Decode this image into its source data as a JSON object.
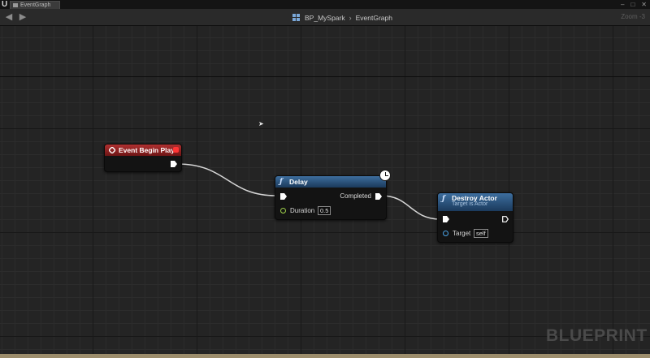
{
  "window": {
    "tab_label": "EventGraph"
  },
  "toolbar": {
    "breadcrumb": [
      "BP_MySpark",
      "EventGraph"
    ],
    "breadcrumb_separator": "›",
    "zoom": "Zoom -3"
  },
  "nodes": {
    "event_begin_play": {
      "title": "Event Begin Play"
    },
    "delay": {
      "title": "Delay",
      "output_label": "Completed",
      "duration_label": "Duration",
      "duration_value": "0.5"
    },
    "destroy_actor": {
      "title": "Destroy Actor",
      "subtitle": "Target is Actor",
      "target_label": "Target",
      "target_value": "self"
    }
  },
  "watermark": "BLUEPRINT",
  "colors": {
    "event_header": "#b03030",
    "function_header": "#3d6e9e",
    "float_pin": "#9ed04a",
    "object_pin": "#4aa3e6",
    "wire": "#d6d6d6"
  }
}
